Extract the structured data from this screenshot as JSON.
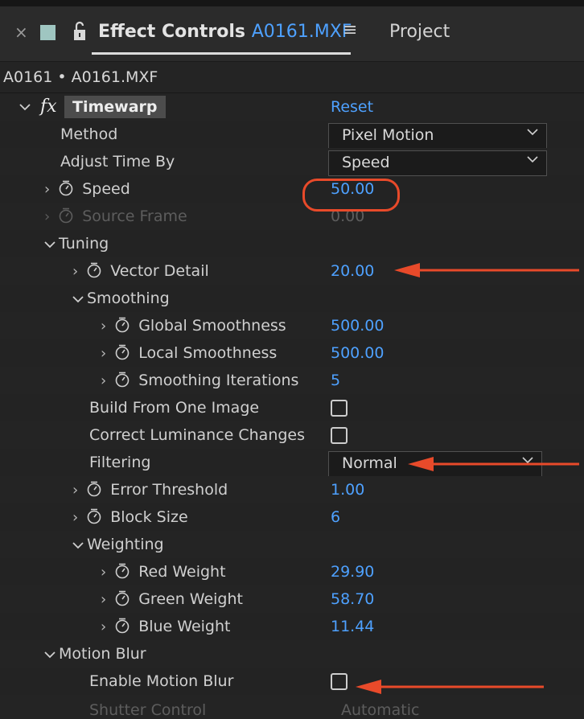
{
  "tab": {
    "close_glyph": "×",
    "lock_icon": "lock-icon",
    "title": "Effect Controls",
    "clip_name": "A0161.MXF",
    "menu_glyph": "≡",
    "other_tab": "Project",
    "swatch_color": "#9fc6c1"
  },
  "clip_path": "A0161 • A0161.MXF",
  "effect": {
    "fx_glyph": "fx",
    "name": "Timewarp",
    "reset_label": "Reset"
  },
  "props": {
    "method": {
      "label": "Method",
      "value": "Pixel Motion"
    },
    "adjust_time_by": {
      "label": "Adjust Time By",
      "value": "Speed"
    },
    "speed": {
      "label": "Speed",
      "value": "50.00"
    },
    "source_frame": {
      "label": "Source Frame",
      "value": "0.00"
    },
    "tuning": {
      "label": "Tuning"
    },
    "vector_detail": {
      "label": "Vector Detail",
      "value": "20.00"
    },
    "smoothing": {
      "label": "Smoothing"
    },
    "global_smoothness": {
      "label": "Global Smoothness",
      "value": "500.00"
    },
    "local_smoothness": {
      "label": "Local Smoothness",
      "value": "500.00"
    },
    "smoothing_iterations": {
      "label": "Smoothing Iterations",
      "value": "5"
    },
    "build_from_one_image": {
      "label": "Build From One Image",
      "checked": false
    },
    "correct_luminance_changes": {
      "label": "Correct Luminance Changes",
      "checked": false
    },
    "filtering": {
      "label": "Filtering",
      "value": "Normal"
    },
    "error_threshold": {
      "label": "Error Threshold",
      "value": "1.00"
    },
    "block_size": {
      "label": "Block Size",
      "value": "6"
    },
    "weighting": {
      "label": "Weighting"
    },
    "red_weight": {
      "label": "Red Weight",
      "value": "29.90"
    },
    "green_weight": {
      "label": "Green Weight",
      "value": "58.70"
    },
    "blue_weight": {
      "label": "Blue Weight",
      "value": "11.44"
    },
    "motion_blur": {
      "label": "Motion Blur"
    },
    "enable_motion_blur": {
      "label": "Enable Motion Blur",
      "checked": false
    },
    "shutter_control": {
      "label": "Shutter Control",
      "value": "Automatic"
    }
  },
  "colors": {
    "value_blue": "#4ea1ff",
    "annotation_red": "#e84a2a",
    "panel_bg": "#232323"
  }
}
